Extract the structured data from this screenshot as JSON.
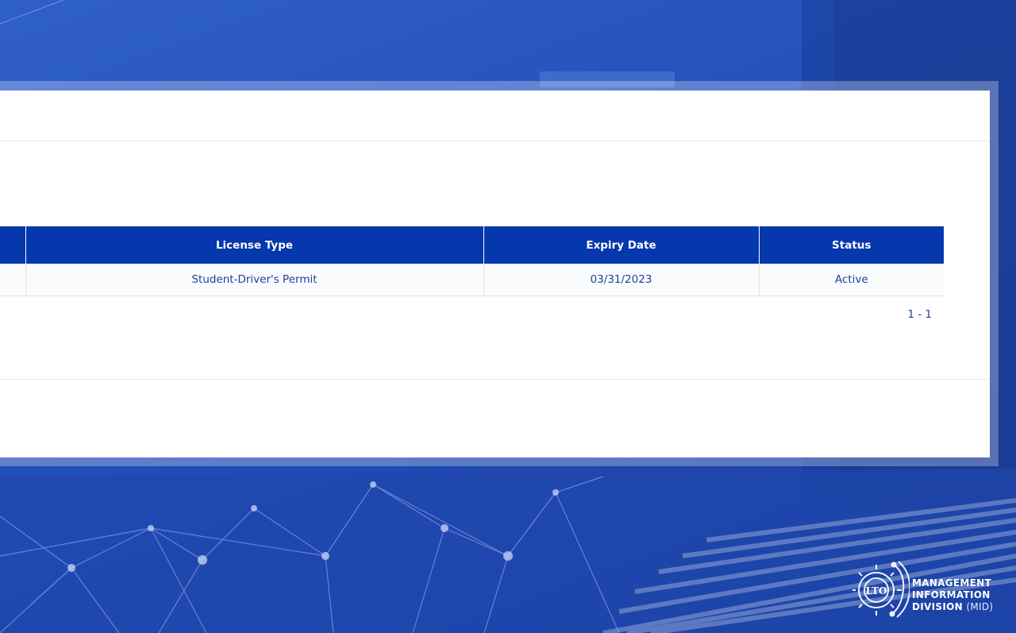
{
  "table": {
    "columns": [
      "",
      "License Type",
      "Expiry Date",
      "Status"
    ],
    "rows": [
      {
        "col0": "",
        "license_type": "Student-Driver's Permit",
        "expiry_date": "03/31/2023",
        "status": "Active"
      }
    ]
  },
  "pager": {
    "range": "1 - 1"
  },
  "branding": {
    "seal_text": "LTO",
    "line1": "MANAGEMENT",
    "line2": "INFORMATION",
    "line3": "DIVISION",
    "line3_suffix": "(MID)"
  },
  "colors": {
    "header_bg": "#0537ad",
    "text_link": "#1f3f9f",
    "background": "#2553be"
  }
}
